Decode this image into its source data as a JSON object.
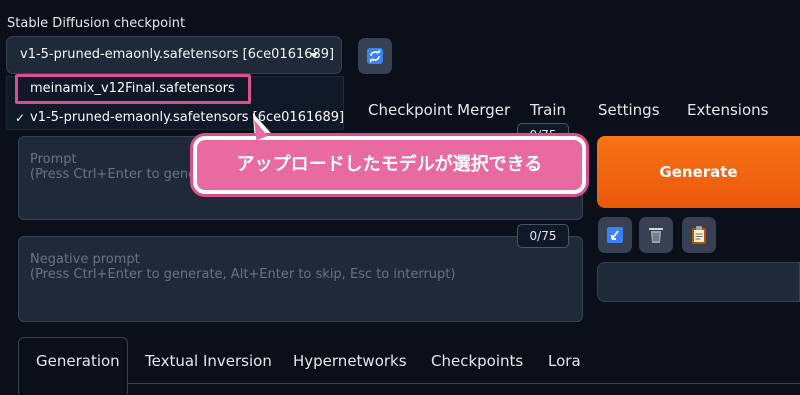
{
  "checkpoint": {
    "label": "Stable Diffusion checkpoint",
    "selected": "v1-5-pruned-emaonly.safetensors [6ce0161689]",
    "options": [
      "meinamix_v12Final.safetensors",
      "v1-5-pruned-emaonly.safetensors [6ce0161689]"
    ],
    "check_mark": "✓"
  },
  "top_tabs": [
    "Checkpoint Merger",
    "Train",
    "Settings",
    "Extensions"
  ],
  "prompt": {
    "title": "Prompt",
    "hint": "(Press Ctrl+Enter to generate",
    "counter": "0/75"
  },
  "negative_prompt": {
    "title": "Negative prompt",
    "hint": "(Press Ctrl+Enter to generate, Alt+Enter to skip, Esc to interrupt)",
    "counter": "0/75"
  },
  "generate_label": "Generate",
  "bottom_tabs": [
    "Generation",
    "Textual Inversion",
    "Hypernetworks",
    "Checkpoints",
    "Lora"
  ],
  "callout": {
    "text": "アップロードしたモデルが選択できる"
  },
  "colors": {
    "accent_orange": "#f97316",
    "callout_pink": "#e96aa0",
    "highlight_border": "#d9508f",
    "background": "#0b0f19"
  },
  "icons": {
    "refresh": "refresh-icon",
    "read_params": "arrow-icon",
    "clear": "trash-icon",
    "paste": "clipboard-icon"
  }
}
